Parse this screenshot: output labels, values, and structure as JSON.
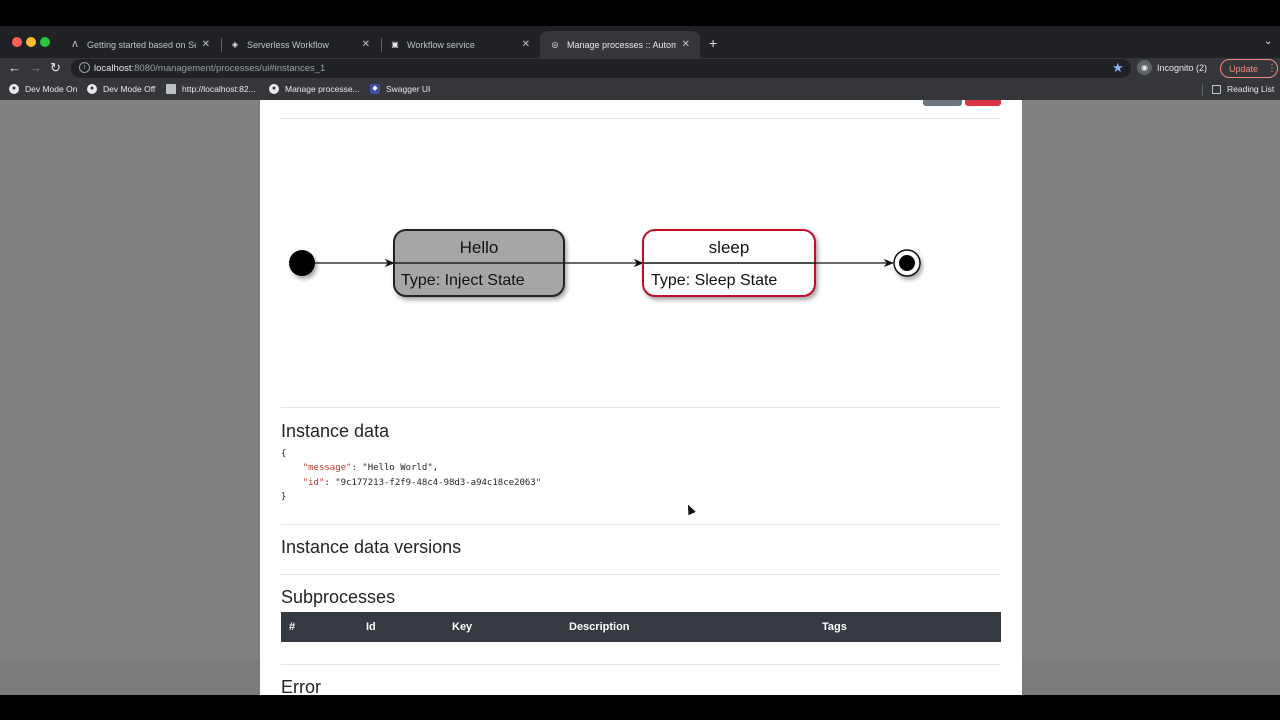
{
  "browser": {
    "tabs": [
      {
        "title": "Getting started based on Serve",
        "icon": "a-icon"
      },
      {
        "title": "Serverless Workflow",
        "icon": "shield-icon"
      },
      {
        "title": "Workflow service",
        "icon": "swagger-icon"
      },
      {
        "title": "Manage processes :: Automati",
        "icon": "globe-icon",
        "active": true
      }
    ],
    "url_host": "localhost",
    "url_rest": ":8080/management/processes/ui#instances_1",
    "incognito_label": "Incognito (2)",
    "update_label": "Update",
    "bookmarks": [
      "Dev Mode On",
      "Dev Mode Off",
      "http://localhost:82...",
      "Manage processe...",
      "Swagger UI"
    ],
    "reading_list": "Reading List"
  },
  "diagram": {
    "states": [
      {
        "name": "Hello",
        "type": "Type: Inject State",
        "status": "completed",
        "fill": "#a6a6a6",
        "border": "#222222"
      },
      {
        "name": "sleep",
        "type": "Type: Sleep State",
        "status": "active",
        "fill": "#ffffff",
        "border": "#c0102a"
      }
    ]
  },
  "instance_data": {
    "title": "Instance data",
    "open": "{",
    "close": "}",
    "entries": [
      {
        "key": "\"message\"",
        "value": " \"Hello World\","
      },
      {
        "key": "\"id\"",
        "value": " \"9c177213-f2f9-48c4-98d3-a94c18ce2063\""
      }
    ]
  },
  "versions": {
    "title": "Instance data versions"
  },
  "subprocesses": {
    "title": "Subprocesses",
    "columns": [
      "#",
      "Id",
      "Key",
      "Description",
      "Tags"
    ]
  },
  "error": {
    "title": "Error"
  }
}
